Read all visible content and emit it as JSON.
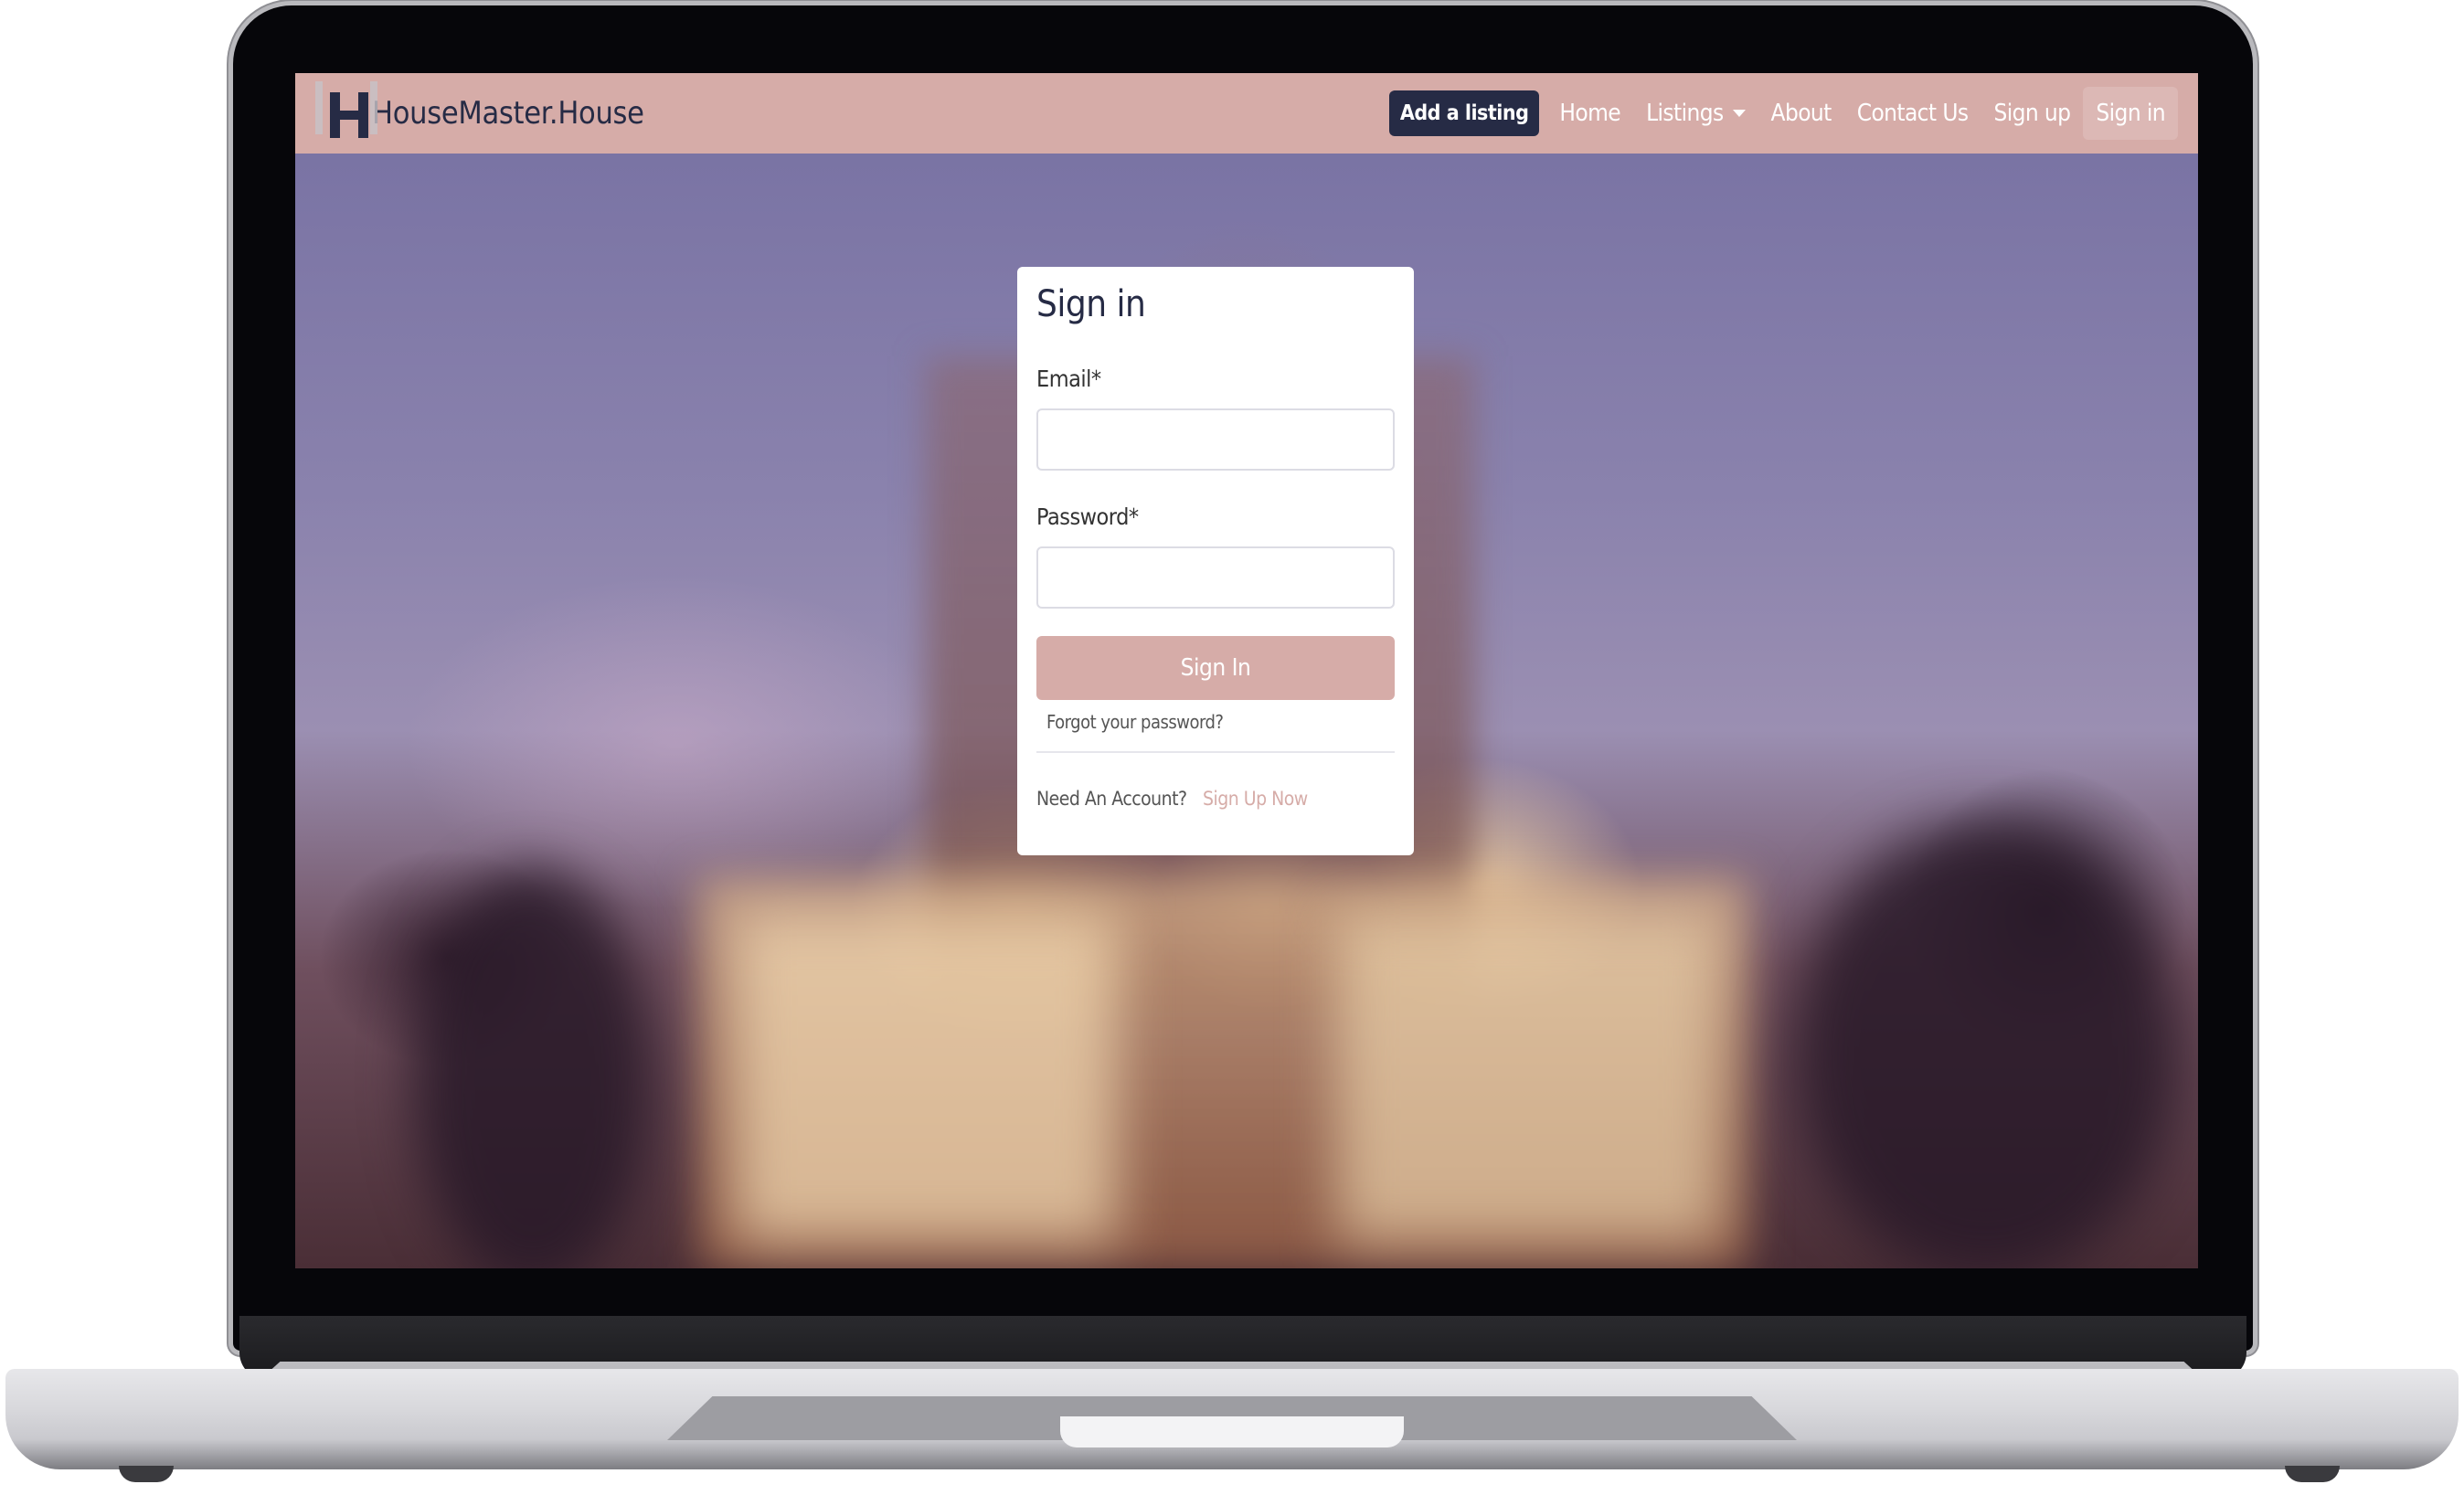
{
  "brand": {
    "name": "HouseMaster.House",
    "logo_icon": "housemaster-h-logo-icon",
    "colors": {
      "primary": "#d6aca8",
      "dark": "#262b45"
    }
  },
  "navbar": {
    "add_listing_label": "Add a listing",
    "links": [
      {
        "label": "Home"
      },
      {
        "label": "Listings",
        "has_dropdown": true
      },
      {
        "label": "About"
      },
      {
        "label": "Contact Us"
      },
      {
        "label": "Sign up"
      },
      {
        "label": "Sign in",
        "active": true
      }
    ]
  },
  "signin_card": {
    "title": "Sign in",
    "email_label": "Email*",
    "email_value": "",
    "password_label": "Password*",
    "password_value": "",
    "submit_label": "Sign In",
    "forgot_label": "Forgot your password?",
    "need_account_text": "Need An Account?",
    "signup_link_label": "Sign Up Now"
  }
}
